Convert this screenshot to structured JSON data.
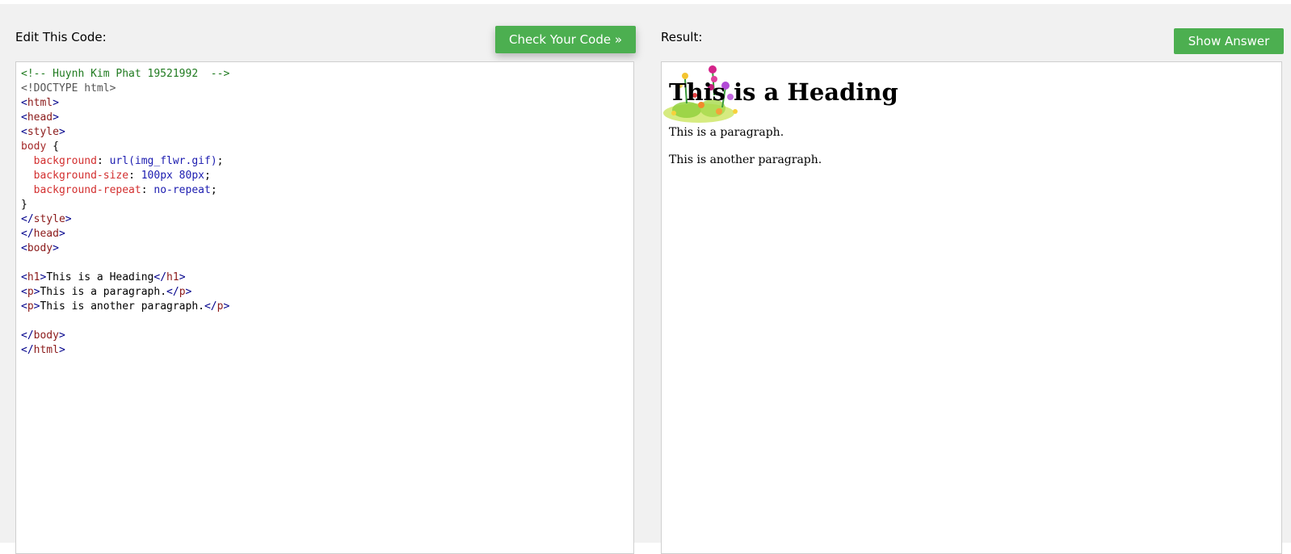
{
  "editor": {
    "title": "Edit This Code:",
    "check_button": "Check Your Code »",
    "code_lines": [
      [
        {
          "t": "<!-- Huynh Kim Phat 19521992  -->",
          "c": "c-comment"
        }
      ],
      [
        {
          "t": "<!DOCTYPE html>",
          "c": "c-doctype"
        }
      ],
      [
        {
          "t": "<",
          "c": "c-tag"
        },
        {
          "t": "html",
          "c": "c-tagname"
        },
        {
          "t": ">",
          "c": "c-tag"
        }
      ],
      [
        {
          "t": "<",
          "c": "c-tag"
        },
        {
          "t": "head",
          "c": "c-tagname"
        },
        {
          "t": ">",
          "c": "c-tag"
        }
      ],
      [
        {
          "t": "<",
          "c": "c-tag"
        },
        {
          "t": "style",
          "c": "c-tagname"
        },
        {
          "t": ">",
          "c": "c-tag"
        }
      ],
      [
        {
          "t": "body",
          "c": "c-sel"
        },
        {
          "t": " {",
          "c": "c-text"
        }
      ],
      [
        {
          "t": "  ",
          "c": "c-text"
        },
        {
          "t": "background",
          "c": "c-prop"
        },
        {
          "t": ": ",
          "c": "c-text"
        },
        {
          "t": "url(img_flwr.gif)",
          "c": "c-val"
        },
        {
          "t": ";",
          "c": "c-text"
        }
      ],
      [
        {
          "t": "  ",
          "c": "c-text"
        },
        {
          "t": "background-size",
          "c": "c-prop"
        },
        {
          "t": ": ",
          "c": "c-text"
        },
        {
          "t": "100px 80px",
          "c": "c-val"
        },
        {
          "t": ";",
          "c": "c-text"
        }
      ],
      [
        {
          "t": "  ",
          "c": "c-text"
        },
        {
          "t": "background-repeat",
          "c": "c-prop"
        },
        {
          "t": ": ",
          "c": "c-text"
        },
        {
          "t": "no-repeat",
          "c": "c-val"
        },
        {
          "t": ";",
          "c": "c-text"
        }
      ],
      [
        {
          "t": "}",
          "c": "c-text"
        }
      ],
      [
        {
          "t": "</",
          "c": "c-tag"
        },
        {
          "t": "style",
          "c": "c-tagname"
        },
        {
          "t": ">",
          "c": "c-tag"
        }
      ],
      [
        {
          "t": "</",
          "c": "c-tag"
        },
        {
          "t": "head",
          "c": "c-tagname"
        },
        {
          "t": ">",
          "c": "c-tag"
        }
      ],
      [
        {
          "t": "<",
          "c": "c-tag"
        },
        {
          "t": "body",
          "c": "c-tagname"
        },
        {
          "t": ">",
          "c": "c-tag"
        }
      ],
      [],
      [
        {
          "t": "<",
          "c": "c-tag"
        },
        {
          "t": "h1",
          "c": "c-tagname"
        },
        {
          "t": ">",
          "c": "c-tag"
        },
        {
          "t": "This is a Heading",
          "c": "c-text"
        },
        {
          "t": "</",
          "c": "c-tag"
        },
        {
          "t": "h1",
          "c": "c-tagname"
        },
        {
          "t": ">",
          "c": "c-tag"
        }
      ],
      [
        {
          "t": "<",
          "c": "c-tag"
        },
        {
          "t": "p",
          "c": "c-tagname"
        },
        {
          "t": ">",
          "c": "c-tag"
        },
        {
          "t": "This is a paragraph.",
          "c": "c-text"
        },
        {
          "t": "</",
          "c": "c-tag"
        },
        {
          "t": "p",
          "c": "c-tagname"
        },
        {
          "t": ">",
          "c": "c-tag"
        }
      ],
      [
        {
          "t": "<",
          "c": "c-tag"
        },
        {
          "t": "p",
          "c": "c-tagname"
        },
        {
          "t": ">",
          "c": "c-tag"
        },
        {
          "t": "This is another paragraph.",
          "c": "c-text"
        },
        {
          "t": "</",
          "c": "c-tag"
        },
        {
          "t": "p",
          "c": "c-tagname"
        },
        {
          "t": ">",
          "c": "c-tag"
        }
      ],
      [],
      [
        {
          "t": "</",
          "c": "c-tag"
        },
        {
          "t": "body",
          "c": "c-tagname"
        },
        {
          "t": ">",
          "c": "c-tag"
        }
      ],
      [
        {
          "t": "</",
          "c": "c-tag"
        },
        {
          "t": "html",
          "c": "c-tagname"
        },
        {
          "t": ">",
          "c": "c-tag"
        }
      ]
    ]
  },
  "result": {
    "title": "Result:",
    "answer_button": "Show Answer",
    "heading": "This is a Heading",
    "paragraph1": "This is a paragraph.",
    "paragraph2": "This is another paragraph.",
    "background_image": "flower-image"
  },
  "colors": {
    "button_green": "#4caf50",
    "page_background": "#f1f1f1"
  }
}
